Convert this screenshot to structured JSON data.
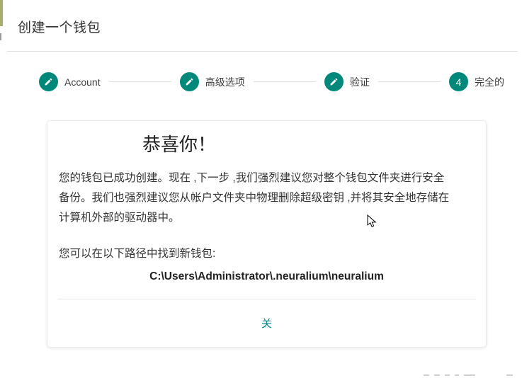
{
  "page_title": "创建一个钱包",
  "stepper": {
    "steps": [
      {
        "label": "Account",
        "indicator": "pencil"
      },
      {
        "label": "高级选项",
        "indicator": "pencil"
      },
      {
        "label": "验证",
        "indicator": "pencil"
      },
      {
        "label": "完全的",
        "indicator": "number",
        "number": "4"
      }
    ]
  },
  "card": {
    "heading": "恭喜你！",
    "body_lines": [
      "您的钱包已成功创建。现在 ,下一步 ,我们强烈建议您对整个钱包文件夹进行安全",
      "备份。我们也强烈建议您从帐户文件夹中物理删除超级密钥 ,并将其安全地存储在",
      "计算机外部的驱动器中。"
    ],
    "path_intro": "您可以在以下路径中找到新钱包:",
    "wallet_path": "C:\\Users\\Administrator\\.neuralium\\neuralium",
    "close_label": "关"
  },
  "colors": {
    "teal": "#00897b",
    "link": "#00838f",
    "connector": "#dbdbdb",
    "divider": "#e0e0e0",
    "olive": "#a8ad6e"
  }
}
